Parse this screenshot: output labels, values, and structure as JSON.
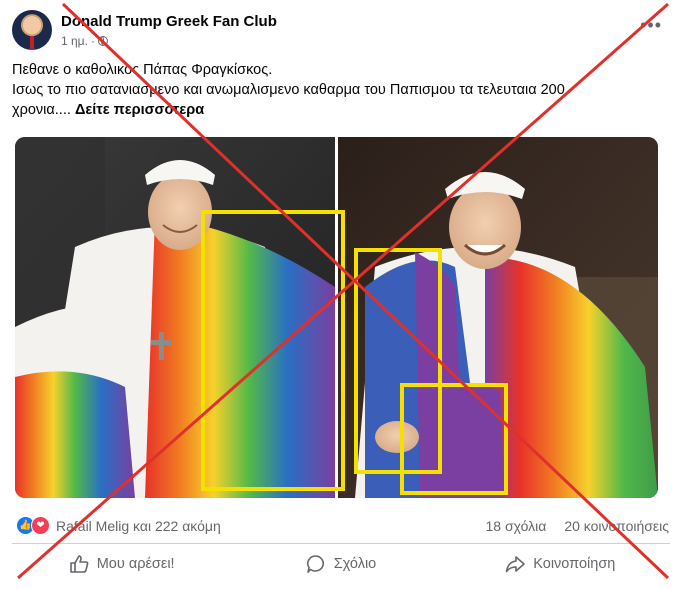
{
  "post": {
    "page_name": "Donald Trump Greek Fan Club",
    "time": "1 ημ.",
    "separator": "·",
    "text_line1": "Πεθανε ο καθολικος Πάπας Φραγκίσκος.",
    "text_line2": "Ισως το πιο σατανιασμενο και ανωμαλισμενο καθαρμα του Παπισμου τα τελευταια 200",
    "text_line3": "χρονια....",
    "see_more": "Δείτε περισσότερα"
  },
  "engagement": {
    "reactors": "Rafail Melig και 222 ακόμη",
    "comments": "18 σχόλια",
    "shares": "20 κοινοποιήσεις"
  },
  "actions": {
    "like": "Μου αρέσει!",
    "comment": "Σχόλιο",
    "share": "Κοινοποίηση"
  },
  "icons": {
    "globe": "globe-icon",
    "more": "more-options-icon",
    "like": "thumbs-up-icon",
    "comment": "comment-bubble-icon",
    "share": "share-arrow-icon"
  },
  "colors": {
    "cross_out": "#e0302c",
    "highlight_box": "#f5e100",
    "like_blue": "#1877f2",
    "love_red": "#f33e58"
  }
}
